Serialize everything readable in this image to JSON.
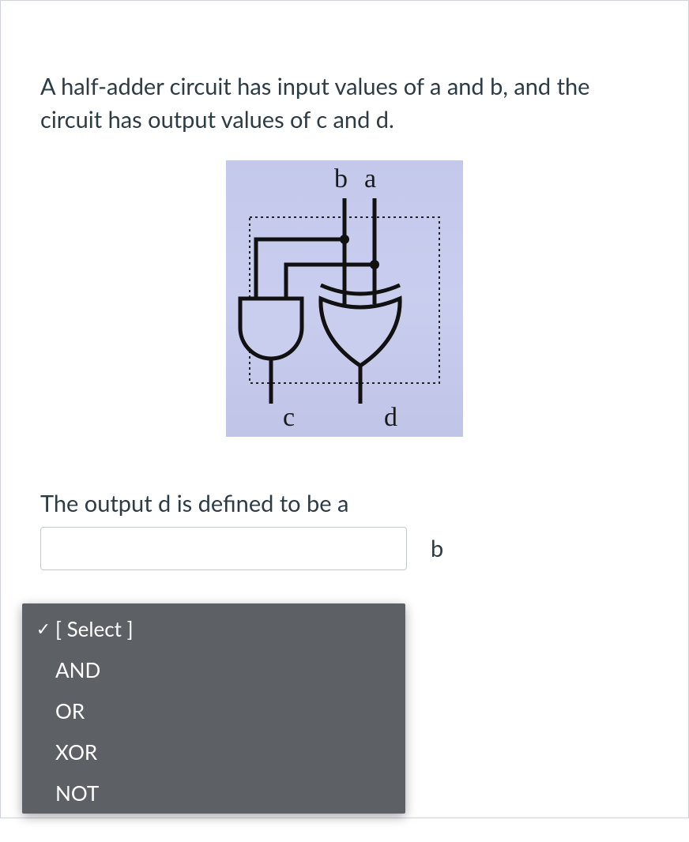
{
  "question": {
    "intro": "A half-adder circuit has input values of a and b, and the circuit has output values of c and d.",
    "prompt": "The output d is defined to be a",
    "after_select": "b"
  },
  "diagram": {
    "top_left_label": "b",
    "top_right_label": "a",
    "bottom_left_label": "c",
    "bottom_right_label": "d"
  },
  "select": {
    "placeholder": "[ Select ]",
    "options": [
      {
        "label": "[ Select ]",
        "selected": true
      },
      {
        "label": "AND",
        "selected": false
      },
      {
        "label": "OR",
        "selected": false
      },
      {
        "label": "XOR",
        "selected": false
      },
      {
        "label": "NOT",
        "selected": false
      }
    ]
  }
}
